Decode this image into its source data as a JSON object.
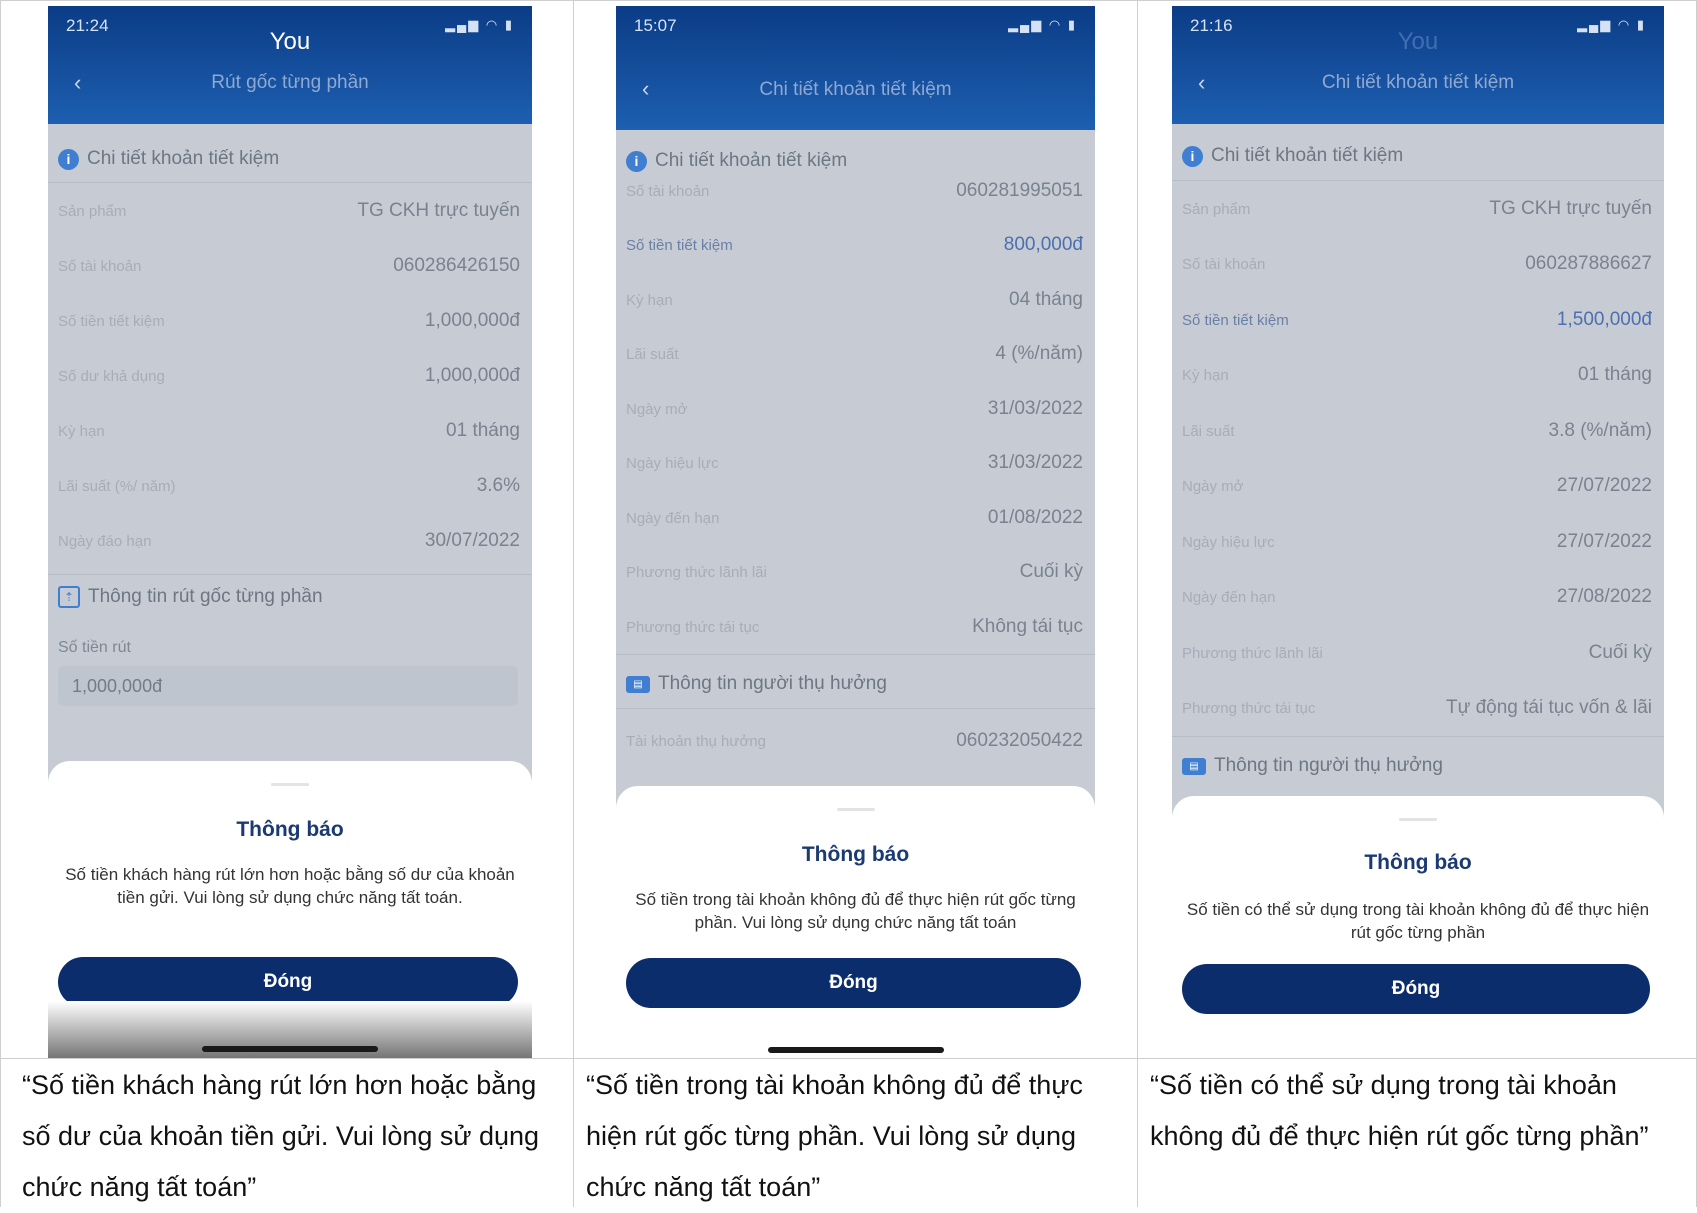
{
  "panels": [
    {
      "status_time": "21:24",
      "carrier": "You",
      "header_title": "Rút gốc từng phần",
      "section1": "Chi tiết khoản tiết kiệm",
      "rows": [
        {
          "label": "Sản phẩm",
          "value": "TG CKH trực tuyến"
        },
        {
          "label": "Số tài khoản",
          "value": "060286426150"
        },
        {
          "label": "Số tiền tiết kiệm",
          "value": "1,000,000đ"
        },
        {
          "label": "Số dư khả dụng",
          "value": "1,000,000đ"
        },
        {
          "label": "Kỳ hạn",
          "value": "01 tháng"
        },
        {
          "label": "Lãi suất (%/ năm)",
          "value": "3.6%"
        },
        {
          "label": "Ngày đáo hạn",
          "value": "30/07/2022"
        }
      ],
      "section2": "Thông tin rút gốc từng phần",
      "field_label": "Số tiền rút",
      "field_value": "1,000,000đ",
      "sheet_title": "Thông báo",
      "sheet_message": "Số tiền khách hàng rút lớn hơn hoặc bằng số dư của khoản tiền gửi. Vui lòng sử dụng chức năng tất toán.",
      "button": "Đóng",
      "caption": "“Số tiền khách hàng rút lớn hơn hoặc bằng số dư của khoản tiền gửi. Vui lòng sử dụng chức năng tất toán”"
    },
    {
      "status_time": "15:07",
      "header_title": "Chi tiết khoản tiết kiệm",
      "section1": "Chi tiết khoản tiết kiệm",
      "rows": [
        {
          "label": "Số tài khoản",
          "value": "060281995051"
        },
        {
          "label": "Số tiền tiết kiệm",
          "value": "800,000đ"
        },
        {
          "label": "Kỳ hạn",
          "value": "04 tháng"
        },
        {
          "label": "Lãi suất",
          "value": "4 (%/năm)"
        },
        {
          "label": "Ngày mở",
          "value": "31/03/2022"
        },
        {
          "label": "Ngày hiệu lực",
          "value": "31/03/2022"
        },
        {
          "label": "Ngày đến hạn",
          "value": "01/08/2022"
        },
        {
          "label": "Phương thức lãnh lãi",
          "value": "Cuối kỳ"
        },
        {
          "label": "Phương thức tái tục",
          "value": "Không tái tục"
        }
      ],
      "section2": "Thông tin người thụ hưởng",
      "beneficiary_row": {
        "label": "Tài khoản thụ hưởng",
        "value": "060232050422"
      },
      "sheet_title": "Thông báo",
      "sheet_message": "Số tiền trong tài khoản không đủ để thực hiện rút gốc từng phần. Vui lòng sử dụng chức năng tất toán",
      "button": "Đóng",
      "caption": "“Số tiền trong tài khoản không đủ để thực hiện rút gốc từng phần. Vui lòng sử dụng chức năng tất toán”"
    },
    {
      "status_time": "21:16",
      "carrier": "You",
      "header_title": "Chi tiết khoản tiết kiệm",
      "section1": "Chi tiết khoản tiết kiệm",
      "rows": [
        {
          "label": "Sản phẩm",
          "value": "TG CKH trực tuyến"
        },
        {
          "label": "Số tài khoản",
          "value": "060287886627"
        },
        {
          "label": "Số tiền tiết kiệm",
          "value": "1,500,000đ"
        },
        {
          "label": "Kỳ hạn",
          "value": "01 tháng"
        },
        {
          "label": "Lãi suất",
          "value": "3.8 (%/năm)"
        },
        {
          "label": "Ngày mở",
          "value": "27/07/2022"
        },
        {
          "label": "Ngày hiệu lực",
          "value": "27/07/2022"
        },
        {
          "label": "Ngày đến hạn",
          "value": "27/08/2022"
        },
        {
          "label": "Phương thức lãnh lãi",
          "value": "Cuối kỳ"
        },
        {
          "label": "Phương thức tái tục",
          "value": "Tự động tái tục vốn & lãi"
        }
      ],
      "section2": "Thông tin người thụ hưởng",
      "sheet_title": "Thông báo",
      "sheet_message": "Số tiền có thể sử dụng trong tài khoản không đủ để thực hiện rút gốc từng phần",
      "button": "Đóng",
      "caption": "“Số tiền có thể sử dụng trong tài khoản không đủ để thực hiện rút gốc từng phần”"
    }
  ],
  "colors": {
    "header": "#0b3c86",
    "button": "#0b2d6b",
    "sheet_title": "#1b3a72",
    "info": "#3f7ed0"
  },
  "icons": {
    "back": "chevron-left-icon",
    "info": "info-icon",
    "withdraw": "withdraw-icon",
    "beneficiary": "id-card-icon"
  }
}
